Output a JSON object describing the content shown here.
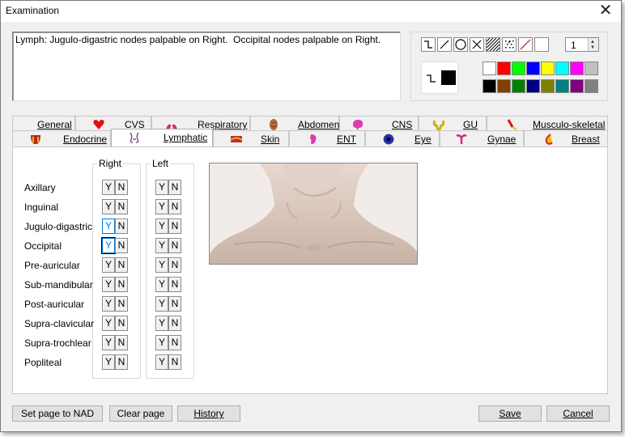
{
  "window": {
    "title": "Examination"
  },
  "notes": {
    "text": "Lymph: Jugulo-digastric nodes palpable on Right.  Occipital nodes palpable on Right."
  },
  "tools": {
    "icons": [
      "step-line-icon",
      "diagonal-line-icon",
      "circle-icon",
      "cross-icon",
      "hatch-fill-icon",
      "dotted-fill-icon",
      "red-pen-icon",
      "blank-tool-icon"
    ],
    "line_width": "1",
    "palette_row1": [
      "#ffffff",
      "#ff0000",
      "#00ff00",
      "#0000ff",
      "#ffff00",
      "#00ffff",
      "#ff00ff",
      "#c0c0c0"
    ],
    "palette_row2": [
      "#000000",
      "#804000",
      "#008000",
      "#000080",
      "#808000",
      "#008080",
      "#800080",
      "#808080"
    ]
  },
  "tabs": {
    "row1": [
      "General",
      "CVS",
      "Respiratory",
      "Abdomen",
      "CNS",
      "GU",
      "Musculo-skeletal"
    ],
    "row2": [
      "Endocrine",
      "Lymphatic",
      "Skin",
      "ENT",
      "Eye",
      "Gynae",
      "Breast"
    ],
    "selected": "Lymphatic"
  },
  "lymph": {
    "right_heading": "Right",
    "left_heading": "Left",
    "yes": "Y",
    "no": "N",
    "nodes": [
      "Axillary",
      "Inguinal",
      "Jugulo-digastric",
      "Occipital",
      "Pre-auricular",
      "Sub-mandibular",
      "Post-auricular",
      "Supra-clavicular",
      "Supra-trochlear",
      "Popliteal"
    ],
    "right_selected": [
      "Jugulo-digastric",
      "Occipital"
    ]
  },
  "buttons": {
    "nad": "Set page to NAD",
    "clear": "Clear page",
    "history": "History",
    "save": "Save",
    "cancel": "Cancel"
  }
}
